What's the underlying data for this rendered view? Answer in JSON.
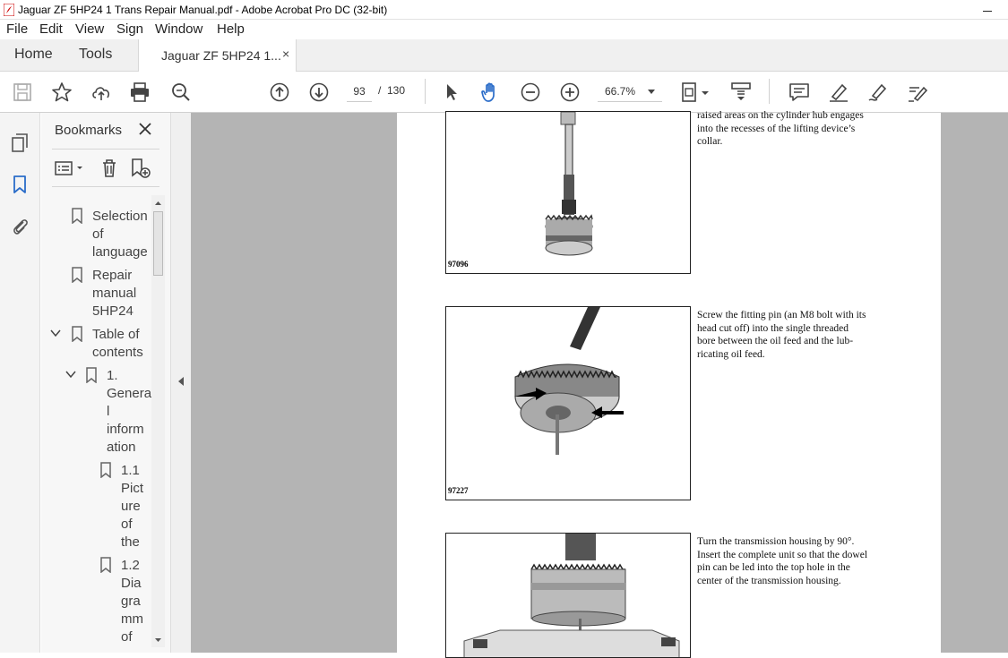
{
  "window": {
    "title": "Jaguar ZF 5HP24 1 Trans Repair Manual.pdf - Adobe Acrobat Pro DC (32-bit)"
  },
  "menu": [
    "File",
    "Edit",
    "View",
    "Sign",
    "Window",
    "Help"
  ],
  "tabs": {
    "home": "Home",
    "tools": "Tools",
    "document": "Jaguar ZF 5HP24 1...",
    "close_glyph": "×"
  },
  "toolbar": {
    "current_page": "93",
    "page_separator": "/",
    "total_pages": "130",
    "zoom": "66.7%"
  },
  "bookmarks": {
    "header": "Bookmarks",
    "close_glyph": "✕",
    "items": [
      {
        "lines": [
          "Selection",
          "of",
          "language"
        ]
      },
      {
        "lines": [
          "Repair",
          "manual",
          "5HP24"
        ]
      },
      {
        "lines": [
          "Table of",
          "contents"
        ]
      },
      {
        "lines": [
          "1.",
          "Genera",
          "l",
          "inform",
          "ation"
        ]
      },
      {
        "lines": [
          "1.1",
          "Pict",
          "ure",
          "of",
          "the"
        ]
      },
      {
        "lines": [
          "1.2",
          "Dia",
          "gra",
          "mm",
          "of"
        ]
      }
    ]
  },
  "document": {
    "figures": [
      {
        "caption": "97096",
        "text": [
          "raised areas on the cylinder hub engages",
          "into the recesses of the lifting device’s",
          "collar."
        ]
      },
      {
        "caption": "97227",
        "text": [
          "Screw the fitting pin (an M8 bolt with its",
          "head cut off) into the single threaded",
          "bore between the oil feed and the lub-",
          "ricating oil feed."
        ]
      },
      {
        "caption": "",
        "text": [
          "Turn the transmission housing by 90°.",
          "Insert the complete unit so that the dowel",
          "pin can be led into the top hole in the",
          "center of the transmission housing."
        ]
      }
    ]
  },
  "colors": {
    "accent_blue": "#2b6dc9",
    "doc_background": "#b4b4b4",
    "panel_background": "#f7f7f7"
  }
}
